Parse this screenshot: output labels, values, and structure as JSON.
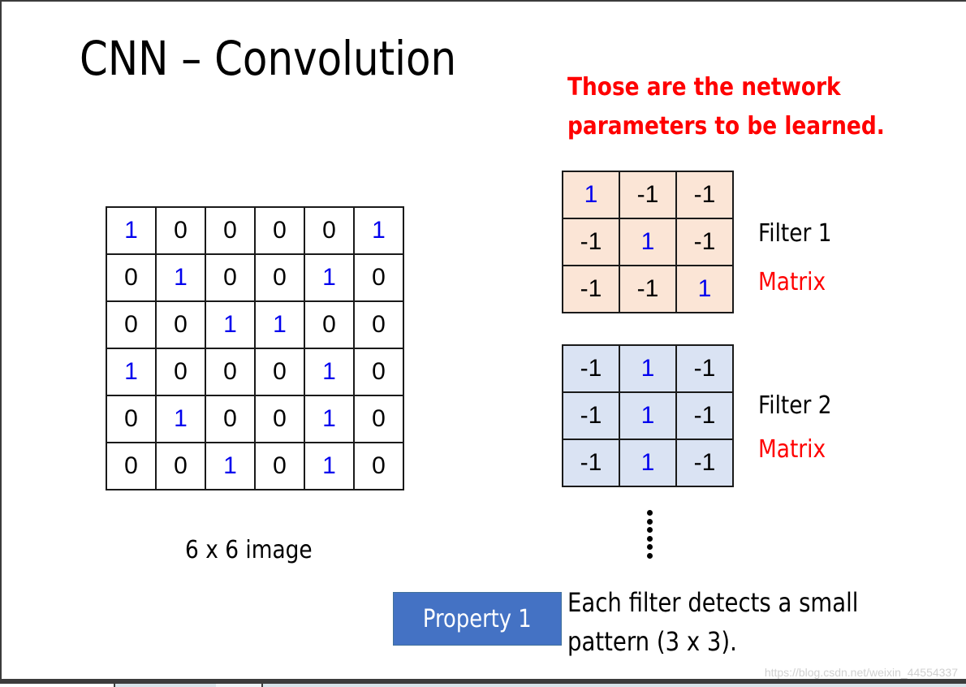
{
  "slide": {
    "title": "CNN – Convolution",
    "note_lines": [
      "Those are the network",
      "parameters to be learned."
    ],
    "colors": {
      "note": "#ff0000",
      "one_digit": "#0000ee",
      "filter1_bg": "#fbe5d6",
      "filter2_bg": "#dae3f3",
      "property_bg": "#4472c4"
    },
    "image": {
      "caption": "6 x 6 image",
      "rows": [
        [
          "1",
          "0",
          "0",
          "0",
          "0",
          "1"
        ],
        [
          "0",
          "1",
          "0",
          "0",
          "1",
          "0"
        ],
        [
          "0",
          "0",
          "1",
          "1",
          "0",
          "0"
        ],
        [
          "1",
          "0",
          "0",
          "0",
          "1",
          "0"
        ],
        [
          "0",
          "1",
          "0",
          "0",
          "1",
          "0"
        ],
        [
          "0",
          "0",
          "1",
          "0",
          "1",
          "0"
        ]
      ]
    },
    "filters": [
      {
        "label": "Filter 1",
        "sublabel": "Matrix",
        "rows": [
          [
            "1",
            "-1",
            "-1"
          ],
          [
            "-1",
            "1",
            "-1"
          ],
          [
            "-1",
            "-1",
            "1"
          ]
        ]
      },
      {
        "label": "Filter 2",
        "sublabel": "Matrix",
        "rows": [
          [
            "-1",
            "1",
            "-1"
          ],
          [
            "-1",
            "1",
            "-1"
          ],
          [
            "-1",
            "1",
            "-1"
          ]
        ]
      }
    ],
    "ellipsis": "vertical-dots",
    "property": {
      "label": "Property 1",
      "text_lines": [
        "Each filter detects a small",
        "pattern (3 x 3)."
      ]
    },
    "watermark": "https://blog.csdn.net/weixin_44554337"
  }
}
